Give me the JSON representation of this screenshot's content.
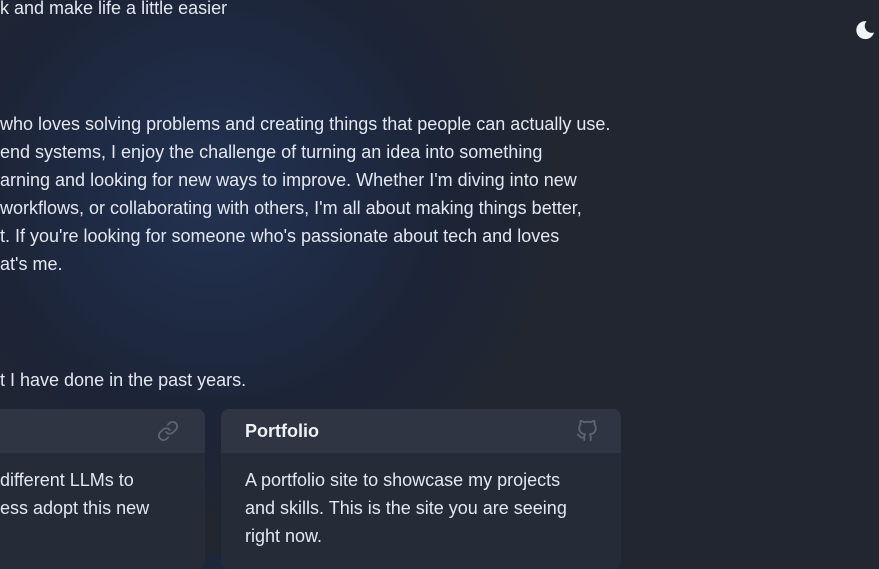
{
  "hero": {
    "tagline": "k and make life a little easier"
  },
  "about": {
    "lines": [
      " who loves solving problems and creating things that people can actually use.",
      "end systems, I enjoy the challenge of turning an idea into something",
      "arning and looking for new ways to improve. Whether I'm diving into new",
      " workflows, or collaborating with others, I'm all about making things better,",
      "t. If you're looking for someone who's passionate about tech and loves",
      "at's me."
    ]
  },
  "projects": {
    "intro": "t I have done in the past years.",
    "cards": [
      {
        "title": "",
        "icon": "link-icon",
        "description": [
          " different LLMs to",
          "ess adopt this new"
        ]
      },
      {
        "title": "Portfolio",
        "icon": "github-icon",
        "description": [
          "A portfolio site to showcase my projects",
          "and skills. This is the site you are seeing",
          "right now."
        ]
      }
    ]
  },
  "theme_toggle": {
    "icon": "moon-icon"
  }
}
